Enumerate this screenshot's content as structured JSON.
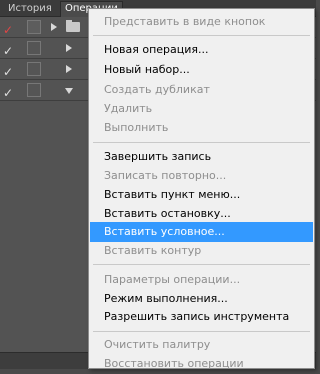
{
  "panel": {
    "tabs": [
      {
        "label": "История"
      },
      {
        "label": "Операции"
      }
    ]
  },
  "menu": {
    "items": [
      {
        "label": "Представить в виде кнопок",
        "disabled": true
      },
      {
        "label": "Новая операция...",
        "disabled": false
      },
      {
        "label": "Новый набор...",
        "disabled": false
      },
      {
        "label": "Создать дубликат",
        "disabled": true
      },
      {
        "label": "Удалить",
        "disabled": true
      },
      {
        "label": "Выполнить",
        "disabled": true
      },
      {
        "label": "Завершить запись",
        "disabled": false
      },
      {
        "label": "Записать повторно...",
        "disabled": true
      },
      {
        "label": "Вставить пункт меню...",
        "disabled": false
      },
      {
        "label": "Вставить остановку...",
        "disabled": false
      },
      {
        "label": "Вставить условное...",
        "disabled": false,
        "highlighted": true
      },
      {
        "label": "Вставить контур",
        "disabled": true
      },
      {
        "label": "Параметры операции...",
        "disabled": true
      },
      {
        "label": "Режим выполнения...",
        "disabled": false
      },
      {
        "label": "Разрешить запись инструмента",
        "disabled": false
      },
      {
        "label": "Очистить палитру",
        "disabled": true
      },
      {
        "label": "Восстановить операции",
        "disabled": true
      }
    ]
  },
  "colors": {
    "highlight": "#3399ff",
    "disabled_text": "#8e8e8e",
    "check_red": "#e04545"
  }
}
